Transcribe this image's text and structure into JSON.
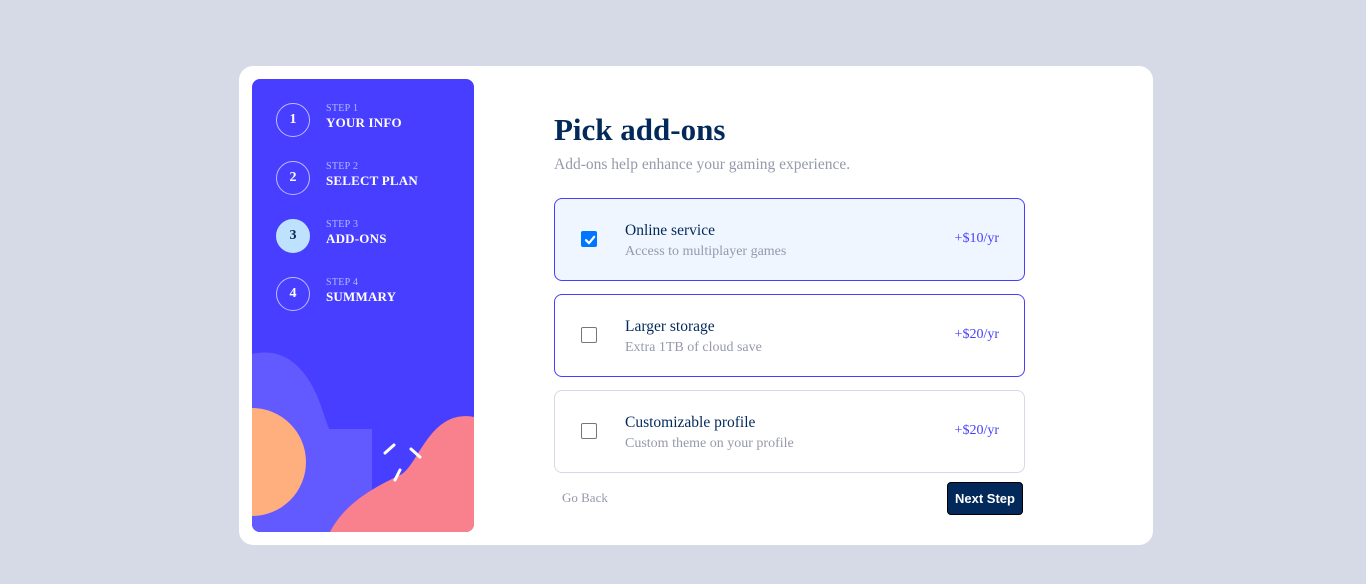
{
  "sidebar": {
    "steps": [
      {
        "number": "1",
        "label": "STEP 1",
        "title": "YOUR INFO",
        "active": false
      },
      {
        "number": "2",
        "label": "STEP 2",
        "title": "SELECT PLAN",
        "active": false
      },
      {
        "number": "3",
        "label": "STEP 3",
        "title": "ADD-ONS",
        "active": true
      },
      {
        "number": "4",
        "label": "STEP 4",
        "title": "SUMMARY",
        "active": false
      }
    ]
  },
  "main": {
    "title": "Pick add-ons",
    "subtitle": "Add-ons help enhance your gaming experience.",
    "addons": [
      {
        "name": "Online service",
        "description": "Access to multiplayer games",
        "price": "+$10/yr",
        "checked": true
      },
      {
        "name": "Larger storage",
        "description": "Extra 1TB of cloud save",
        "price": "+$20/yr",
        "checked": false
      },
      {
        "name": "Customizable profile",
        "description": "Custom theme on your profile",
        "price": "+$20/yr",
        "checked": false
      }
    ]
  },
  "footer": {
    "back_label": "Go Back",
    "next_label": "Next Step"
  },
  "colors": {
    "page_background": "#d6d9e6",
    "sidebar_background": "#483eff",
    "primary_text": "#02295a",
    "muted_text": "#9699ab",
    "accent": "#483eff",
    "selected_background": "#f0f6ff",
    "active_step": "#bee2fd",
    "next_button": "#02295a"
  },
  "icons": [
    "checkmark-icon"
  ]
}
